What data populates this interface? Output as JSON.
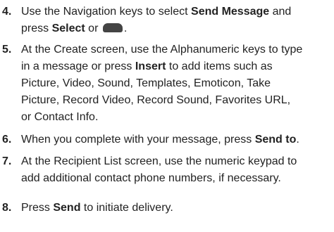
{
  "steps": [
    {
      "number": "4.",
      "lines": [
        [
          "Use the Navigation keys to select ",
          "Send Message",
          " and"
        ],
        [
          "press ",
          "Select",
          " or ",
          "."
        ]
      ]
    },
    {
      "number": "5.",
      "lines": [
        [
          "At the Create screen, use the Alphanumeric keys to type"
        ],
        [
          "in a message or press ",
          "Insert",
          " to add items such as"
        ],
        [
          "Picture, Video, Sound, Templates, Emoticon, Take"
        ],
        [
          "Picture, Record Video, Record Sound, Favorites URL,"
        ],
        [
          "or Contact Info."
        ]
      ]
    },
    {
      "number": "6.",
      "lines": [
        [
          "When you complete with your message, press ",
          "Send to",
          "."
        ]
      ]
    },
    {
      "number": "7.",
      "lines": [
        [
          "At the Recipient List screen, use the numeric keypad to"
        ],
        [
          "add additional contact phone numbers, if necessary."
        ]
      ]
    },
    {
      "number": "8.",
      "lines": [
        [
          "Press ",
          "Send",
          " to initiate delivery."
        ]
      ]
    }
  ],
  "icons": {
    "softkey": "left-softkey-icon"
  },
  "colors": {
    "text": "#222222",
    "icon": "#444444"
  }
}
